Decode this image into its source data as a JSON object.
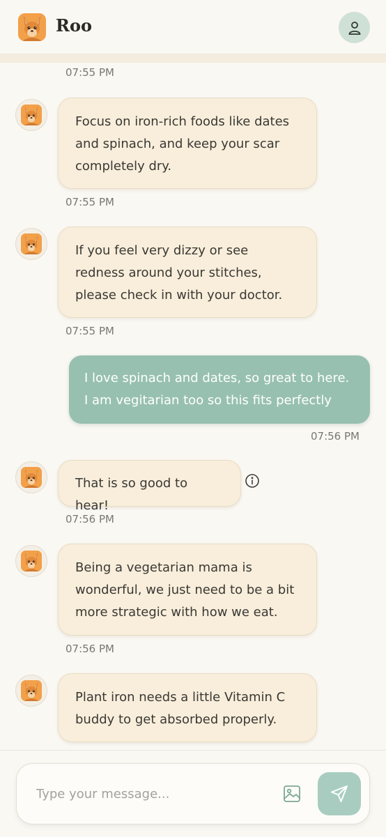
{
  "header": {
    "app_name": "Roo",
    "logo_icon": "kangaroo-logo-icon",
    "profile_icon": "user-icon"
  },
  "messages": [
    {
      "from": "bot",
      "time": "07:55 PM"
    },
    {
      "from": "bot",
      "lines": [
        "Focus on iron-rich foods like dates",
        "and spinach, and keep your scar",
        "completely dry."
      ],
      "time": "07:55 PM"
    },
    {
      "from": "bot",
      "lines": [
        "If you feel very dizzy or see",
        "redness around your stitches,",
        "please check in with your doctor."
      ],
      "time": "07:55 PM"
    },
    {
      "from": "user",
      "lines": [
        "I love spinach and dates, so great to here.",
        "I am vegitarian too so this fits perfectly"
      ],
      "time": "07:56 PM"
    },
    {
      "from": "bot",
      "lines": [
        "That is so good to hear!"
      ],
      "time": "07:56 PM",
      "info_icon": "info-icon"
    },
    {
      "from": "bot",
      "lines": [
        "Being a vegetarian mama is",
        "wonderful, we just need to be a bit",
        "more strategic with how we eat."
      ],
      "time": "07:56 PM"
    },
    {
      "from": "bot",
      "lines": [
        "Plant iron needs a little Vitamin C",
        "buddy to get absorbed properly."
      ]
    }
  ],
  "composer": {
    "placeholder": "Type your message...",
    "value": "",
    "image_icon": "image-icon",
    "send_icon": "send-icon"
  },
  "colors": {
    "background": "#faf8f3",
    "bot_bubble": "#f8eedb",
    "user_bubble": "#97c0b1",
    "send_button": "#a8cdc0",
    "profile_button": "#cfe0d6"
  }
}
